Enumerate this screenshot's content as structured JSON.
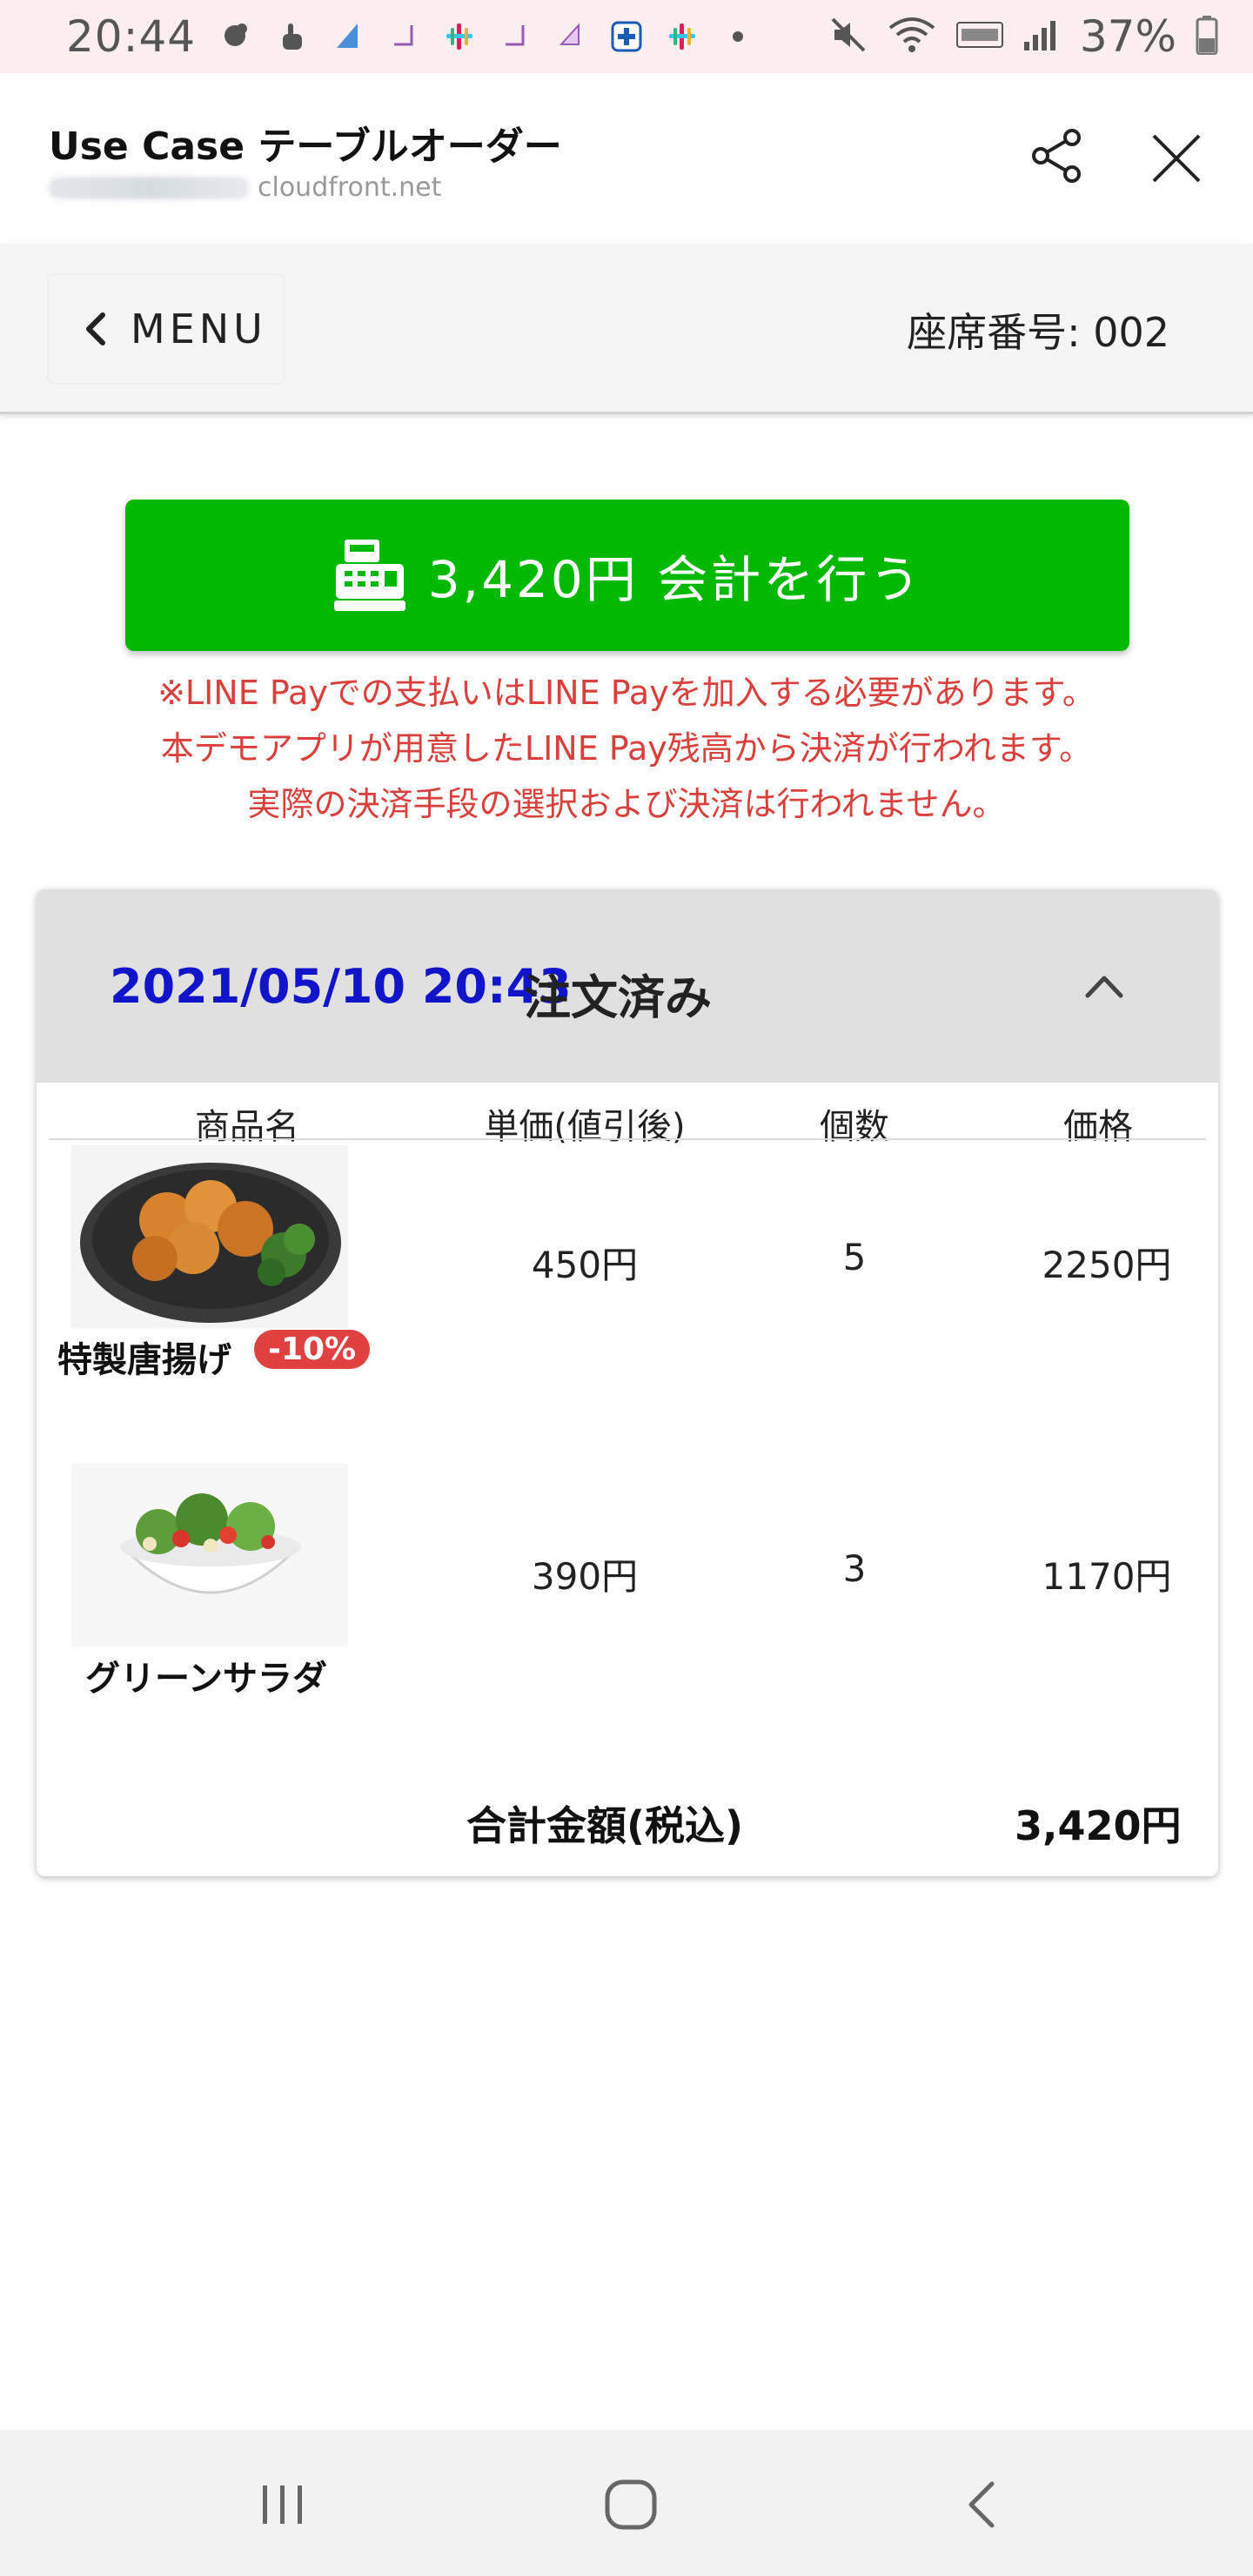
{
  "status_bar": {
    "time": "20:44",
    "battery": "37%",
    "icons": [
      "app-icon",
      "touch-icon",
      "triangle-app-icon",
      "purple-app-icon",
      "slack-icon",
      "purple-app-icon",
      "purple-app-icon",
      "plus-app-icon",
      "slack-icon",
      "dot-icon",
      "mute-icon",
      "wifi-icon",
      "volte-icon",
      "signal-icon",
      "battery-icon"
    ]
  },
  "browser": {
    "title": "Use Case テーブルオーダー",
    "domain": "cloudfront.net"
  },
  "header": {
    "menu_label": "MENU",
    "seat_label": "座席番号: 002"
  },
  "payment": {
    "button_label": "3,420円 会計を行う",
    "notes": [
      "※LINE Payでの支払いはLINE Payを加入する必要があります。",
      "本デモアプリが用意したLINE Pay残高から決済が行われます。",
      "実際の決済手段の選択および決済は行われません。"
    ]
  },
  "order": {
    "datetime": "2021/05/10 20:43",
    "status": "注文済み",
    "columns": [
      "商品名",
      "単価(値引後)",
      "個数",
      "価格"
    ],
    "items": [
      {
        "name": "特製唐揚げ",
        "badge": "-10%",
        "unit_price": "450円",
        "qty": "5",
        "price": "2250円"
      },
      {
        "name": "グリーンサラダ",
        "badge": "",
        "unit_price": "390円",
        "qty": "3",
        "price": "1170円"
      }
    ],
    "total_label": "合計金額(税込)",
    "total_value": "3,420円"
  },
  "colors": {
    "pay_green": "#00b900",
    "note_red": "#d9403b",
    "date_blue": "#1214c9",
    "badge_red": "#e04040"
  }
}
